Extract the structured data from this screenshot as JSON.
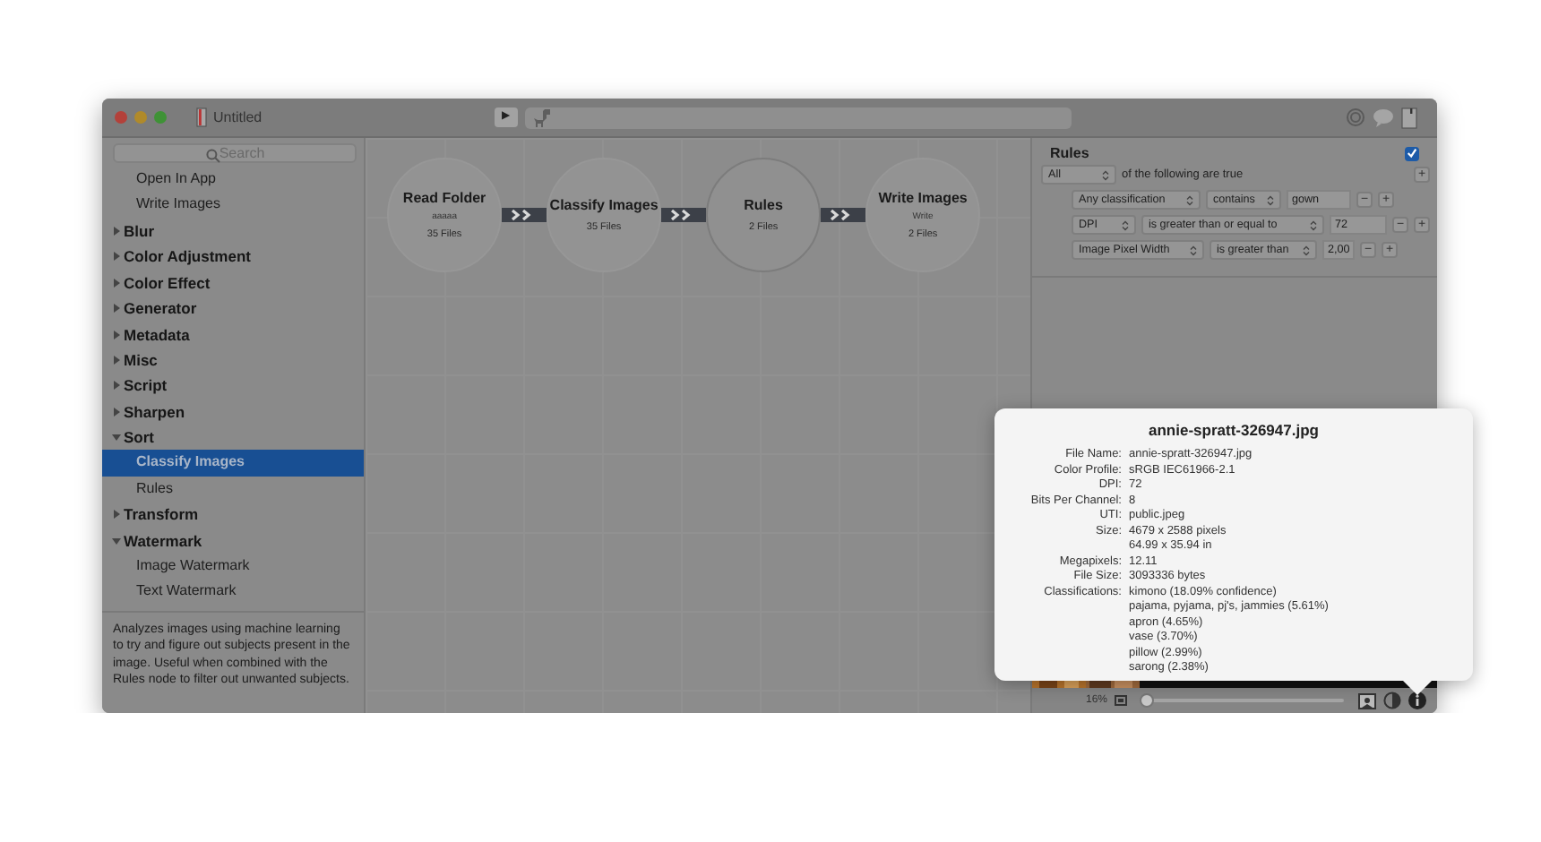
{
  "window": {
    "title": "Untitled"
  },
  "toolbar": {
    "run": "▶"
  },
  "sidebar": {
    "search": {
      "placeholder": "Search"
    },
    "items": [
      {
        "kind": "leaf",
        "label": "Open In App",
        "selected": false
      },
      {
        "kind": "leaf",
        "label": "Write Images",
        "selected": false
      },
      {
        "kind": "category",
        "label": "Blur",
        "expanded": false
      },
      {
        "kind": "category",
        "label": "Color Adjustment",
        "expanded": false
      },
      {
        "kind": "category",
        "label": "Color Effect",
        "expanded": false
      },
      {
        "kind": "category",
        "label": "Generator",
        "expanded": false
      },
      {
        "kind": "category",
        "label": "Metadata",
        "expanded": false
      },
      {
        "kind": "category",
        "label": "Misc",
        "expanded": false
      },
      {
        "kind": "category",
        "label": "Script",
        "expanded": false
      },
      {
        "kind": "category",
        "label": "Sharpen",
        "expanded": false
      },
      {
        "kind": "category",
        "label": "Sort",
        "expanded": true,
        "children": [
          {
            "label": "Classify Images",
            "selected": true
          },
          {
            "label": "Rules",
            "selected": false
          }
        ]
      },
      {
        "kind": "category",
        "label": "Transform",
        "expanded": false
      },
      {
        "kind": "category",
        "label": "Watermark",
        "expanded": true,
        "children": [
          {
            "label": "Image Watermark",
            "selected": false
          },
          {
            "label": "Text Watermark",
            "selected": false
          }
        ]
      }
    ],
    "description": "Analyzes images using machine learning to try and figure out subjects present in the image. Useful when combined with the Rules node to filter out unwanted subjects."
  },
  "nodes": [
    {
      "title": "Read Folder",
      "subtitle": "aaaaa",
      "count": "35 Files",
      "selected": false
    },
    {
      "title": "Classify Images",
      "count": "35 Files",
      "selected": false
    },
    {
      "title": "Rules",
      "count": "2 Files",
      "selected": true
    },
    {
      "title": "Write Images",
      "subtitle": "Write",
      "count": "2 Files",
      "selected": false
    }
  ],
  "rules": {
    "title": "Rules",
    "enabled": true,
    "match": "All",
    "match_text": "of the following are true",
    "add": "+",
    "conditions": [
      {
        "field": "Any classification",
        "operator": "contains",
        "value": "gown",
        "remove": "−",
        "add": "+"
      },
      {
        "field": "DPI",
        "operator": "is greater than or equal to",
        "value": "72",
        "remove": "−",
        "add": "+"
      },
      {
        "field": "Image Pixel Width",
        "operator": "is greater than",
        "value": "2,00",
        "remove": "−",
        "add": "+"
      }
    ]
  },
  "bottom_bar": {
    "zoom": "16%",
    "zoom_slider": {
      "level": 0.03
    }
  },
  "info_popover": {
    "title": "annie-spratt-326947.jpg",
    "rows": [
      {
        "label": "File Name:",
        "values": [
          "annie-spratt-326947.jpg"
        ]
      },
      {
        "label": "Color Profile:",
        "values": [
          "sRGB IEC61966-2.1"
        ]
      },
      {
        "label": "DPI:",
        "values": [
          "72"
        ]
      },
      {
        "label": "Bits Per Channel:",
        "values": [
          "8"
        ]
      },
      {
        "label": "UTI:",
        "values": [
          "public.jpeg"
        ]
      },
      {
        "label": "Size:",
        "values": [
          "4679 x 2588 pixels",
          "64.99 x 35.94 in"
        ]
      },
      {
        "label": "Megapixels:",
        "values": [
          "12.11"
        ]
      },
      {
        "label": "File Size:",
        "values": [
          "3093336 bytes"
        ]
      },
      {
        "label": "Classifications:",
        "values": [
          "kimono (18.09% confidence)",
          "pajama, pyjama, pj's, jammies (5.61%)",
          "apron (4.65%)",
          "vase (3.70%)",
          "pillow (2.99%)",
          "sarong (2.38%)"
        ]
      }
    ]
  }
}
